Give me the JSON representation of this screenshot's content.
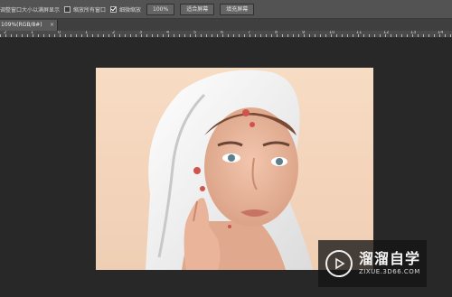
{
  "options_bar": {
    "resize_windows_label": "调整窗口大小以满屏显示",
    "zoom_all_windows_label": "缩放所有窗口",
    "scrubby_zoom_label": "细微缩放",
    "scrubby_zoom_checked": true,
    "zoom_all_windows_checked": false,
    "resize_windows_checked": false,
    "buttons": [
      "100%",
      "适合屏幕",
      "填充屏幕"
    ]
  },
  "document_tab": {
    "title": "109%(RGB/8#)",
    "close": "×"
  },
  "ruler": {
    "labels": [
      "2",
      "1",
      "0",
      "1",
      "2",
      "3",
      "4",
      "5",
      "6",
      "7",
      "8",
      "9",
      "10",
      "11",
      "12",
      "13",
      "14",
      "15",
      "16"
    ]
  },
  "watermark": {
    "title": "溜溜自学",
    "url": "ZIXUE.3D66.COM"
  },
  "colors": {
    "workspace_bg": "#282828",
    "options_bar_bg": "#535353",
    "tab_active_bg": "#5a5a5a"
  }
}
